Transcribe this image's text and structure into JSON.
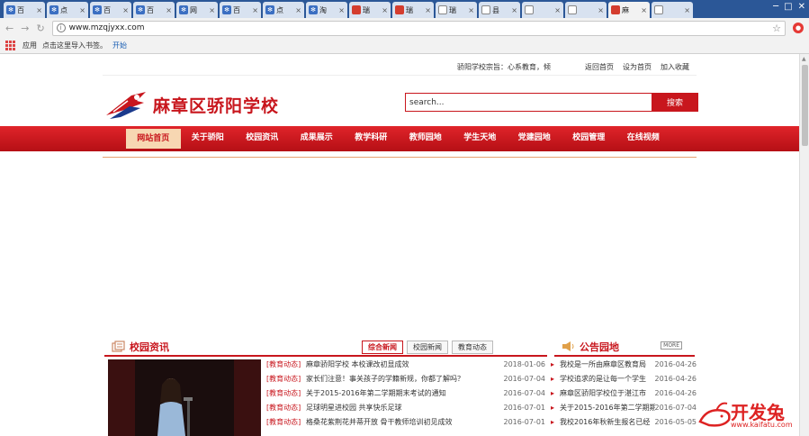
{
  "browser": {
    "tabs": [
      {
        "label": "百",
        "icon": "paw",
        "active": false
      },
      {
        "label": "点",
        "icon": "paw",
        "active": false
      },
      {
        "label": "百",
        "icon": "paw",
        "active": false
      },
      {
        "label": "百",
        "icon": "paw",
        "active": false
      },
      {
        "label": "网",
        "icon": "paw",
        "active": false
      },
      {
        "label": "百",
        "icon": "paw",
        "active": false
      },
      {
        "label": "点",
        "icon": "paw",
        "active": false
      },
      {
        "label": "淘",
        "icon": "paw",
        "active": false
      },
      {
        "label": "瑞",
        "icon": "red",
        "active": false
      },
      {
        "label": "瑞",
        "icon": "red",
        "active": false
      },
      {
        "label": "瑞",
        "icon": "doc",
        "active": false
      },
      {
        "label": "县",
        "icon": "doc",
        "active": false
      },
      {
        "label": "",
        "icon": "doc",
        "active": false
      },
      {
        "label": "",
        "icon": "doc",
        "active": false
      },
      {
        "label": "麻",
        "icon": "red",
        "active": true
      },
      {
        "label": "",
        "icon": "doc",
        "active": false
      }
    ],
    "url": "www.mzqjyxx.com",
    "bookmarks": {
      "apps_label": "应用",
      "import_label": "点击这里导入书签。",
      "start_label": "开始"
    }
  },
  "site": {
    "motto": "骄阳学校宗旨：心系教育，倾",
    "top_links": [
      "返回首页",
      "设为首页",
      "加入收藏"
    ],
    "school_name": "麻章区骄阳学校",
    "search_value": "search...",
    "search_button": "搜索",
    "nav": [
      "网站首页",
      "关于骄阳",
      "校园资讯",
      "成果展示",
      "教学科研",
      "教师园地",
      "学生天地",
      "党建园地",
      "校园管理",
      "在线视频"
    ],
    "news": {
      "title": "校园资讯",
      "tabs": [
        "综合新闻",
        "校园新闻",
        "教育动态"
      ],
      "items": [
        {
          "cat": "[教育动态]",
          "title": "麻章骄阳学校 本校课改初显成效",
          "date": "2018-01-06"
        },
        {
          "cat": "[教育动态]",
          "title": "家长们注意！事关孩子的学籍新规，你都了解吗？",
          "date": "2016-07-04"
        },
        {
          "cat": "[教育动态]",
          "title": "关于2015-2016年第二学期期末考试的通知",
          "date": "2016-07-04"
        },
        {
          "cat": "[教育动态]",
          "title": "足球明星进校园 共享快乐足球",
          "date": "2016-07-01"
        },
        {
          "cat": "[教育动态]",
          "title": "格桑花紫荆花并蒂开放 骨干教师培训初见成效",
          "date": "2016-07-01"
        }
      ]
    },
    "notice": {
      "title": "公告园地",
      "more_label": "MORE",
      "items": [
        {
          "title": "我校是一所由麻章区教育局",
          "date": "2016-04-26"
        },
        {
          "title": "学校追求的是让每一个学生",
          "date": "2016-04-26"
        },
        {
          "title": "麻章区骄阳学校位于湛江市",
          "date": "2016-04-26"
        },
        {
          "title": "关于2015-2016年第二学期期",
          "date": "2016-07-04"
        },
        {
          "title": "我校2016年秋新生报名已经",
          "date": "2016-05-05"
        }
      ]
    },
    "watermark": {
      "text": "开发兔",
      "url": "www.kaifatu.com"
    }
  }
}
